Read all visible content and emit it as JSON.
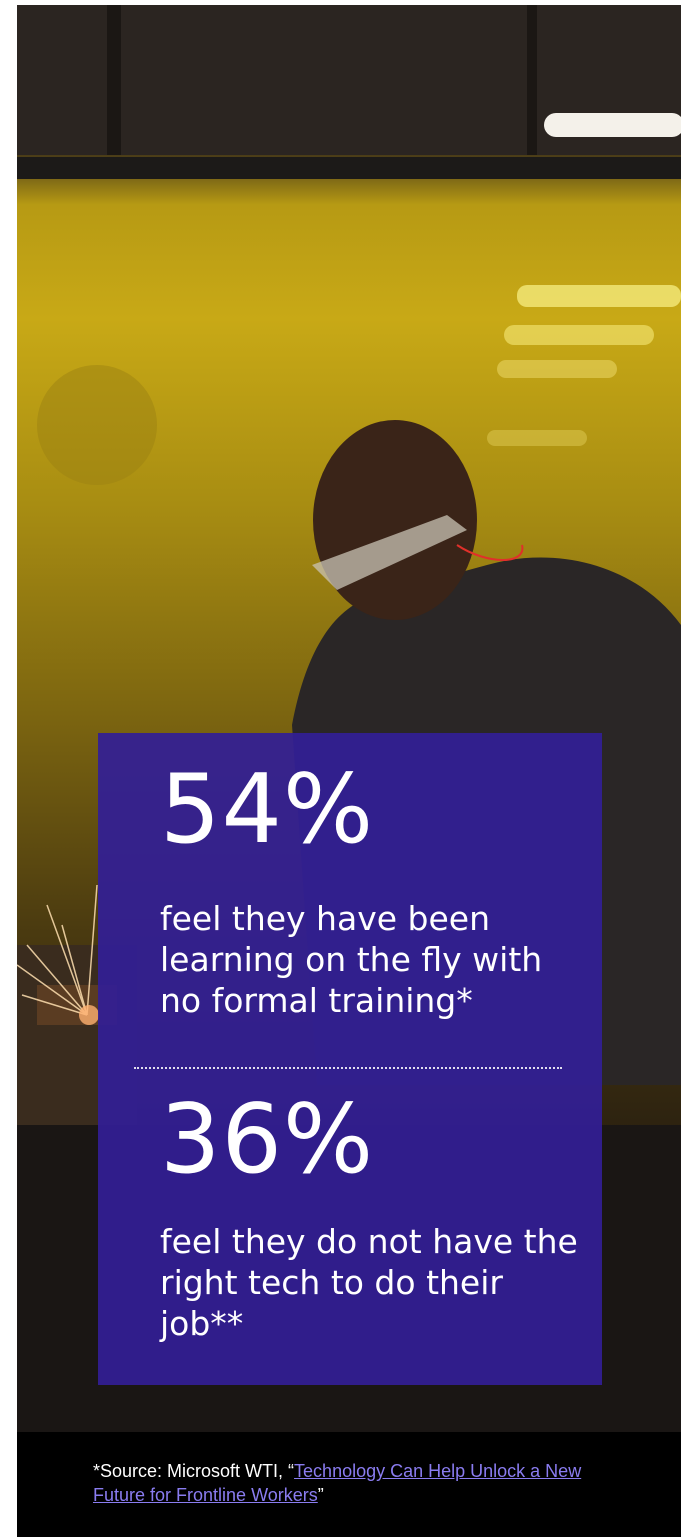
{
  "stats": [
    {
      "value": "54%",
      "description": "feel they have been learning on the fly with no formal training*"
    },
    {
      "value": "36%",
      "description": "feel they do not have the right tech to do their job**"
    }
  ],
  "footer": {
    "source_prefix": "*Source: Microsoft WTI, “",
    "link_text": "Technology Can Help Unlock a New Future for Frontline Workers",
    "source_suffix": "”"
  },
  "colors": {
    "panel": "#321e96",
    "link": "#8a7cf0",
    "footer_bg": "#000000"
  }
}
